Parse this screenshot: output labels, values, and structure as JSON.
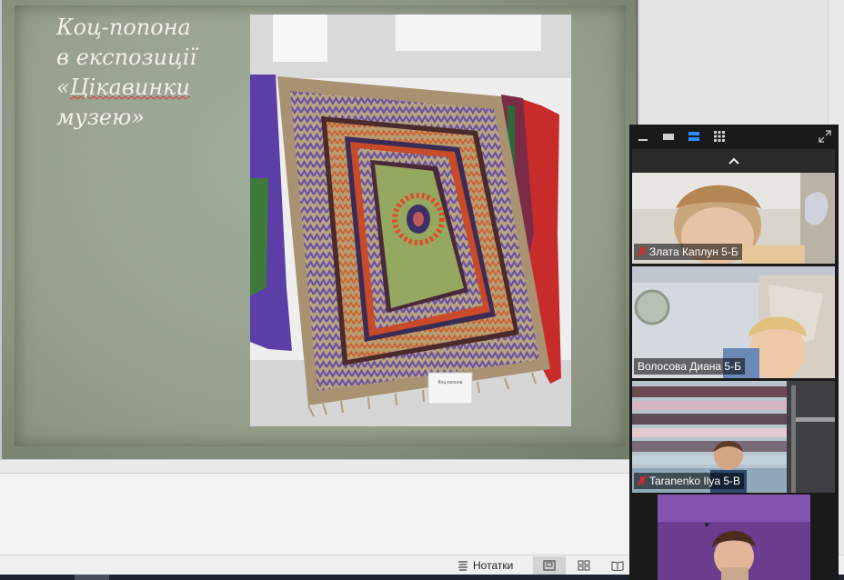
{
  "slide": {
    "title_line1": "Коц-попона",
    "title_line2": "в експозиції",
    "title_line3_open": "«",
    "title_line3_word": "Цікавинки",
    "title_line4": "музею»",
    "photo_label": "Коц-попона"
  },
  "status_bar": {
    "notes_label": "Нотатки"
  },
  "zoom": {
    "participants": [
      {
        "name": "Злата Каплун 5-Б",
        "muted": true
      },
      {
        "name": "Волосова Диана 5-Б",
        "muted": false
      },
      {
        "name": "Taranenko Ilya 5-В",
        "muted": true
      },
      {
        "name": "",
        "muted": false
      }
    ]
  },
  "colors": {
    "slide_green": "#96a08d",
    "zoom_bg": "#1a1a1a",
    "zoom_accent": "#2d8cff",
    "mute_red": "#e02828"
  }
}
